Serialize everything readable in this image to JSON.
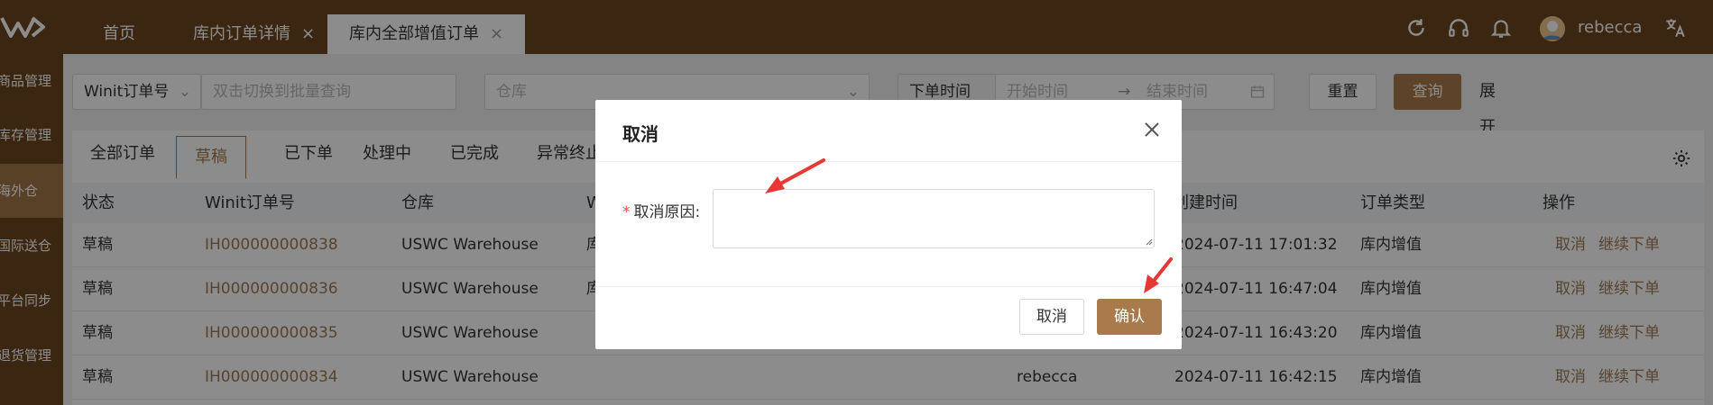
{
  "header": {
    "tabs": [
      {
        "label": "首页"
      },
      {
        "label": "库内订单详情",
        "close": "×"
      },
      {
        "label": "库内全部增值订单",
        "close": "×"
      }
    ],
    "user_name": "rebecca"
  },
  "sidebar": {
    "items": [
      {
        "label": "商品管理"
      },
      {
        "label": "库存管理"
      },
      {
        "label": "海外仓"
      },
      {
        "label": "国际送仓"
      },
      {
        "label": "平台同步"
      },
      {
        "label": "退货管理"
      }
    ]
  },
  "filters": {
    "order_type_select": "Winit订单号",
    "order_search_placeholder": "双击切换到批量查询",
    "warehouse_placeholder": "仓库",
    "time_type_select": "下单时间",
    "start_placeholder": "开始时间",
    "range_arrow": "→",
    "end_placeholder": "结束时间",
    "reset_label": "重置",
    "query_label": "查询",
    "expand_label": "展开"
  },
  "status_tabs": [
    {
      "label": "全部订单"
    },
    {
      "label": "草稿"
    },
    {
      "label": "已下单"
    },
    {
      "label": "处理中"
    },
    {
      "label": "已完成"
    },
    {
      "label": "异常终止"
    }
  ],
  "table": {
    "columns": [
      "状态",
      "Winit订单号",
      "仓库",
      "W",
      "创建时间",
      "订单类型",
      "操作"
    ],
    "rows": [
      {
        "status": "草稿",
        "order": "IH000000000838",
        "warehouse": "USWC Warehouse",
        "w": "库",
        "creator": "",
        "created": "2024-07-11 17:01:32",
        "type": "库内增值",
        "action1": "取消",
        "action2": "继续下单"
      },
      {
        "status": "草稿",
        "order": "IH000000000836",
        "warehouse": "USWC Warehouse",
        "w": "库",
        "creator": "",
        "created": "2024-07-11 16:47:04",
        "type": "库内增值",
        "action1": "取消",
        "action2": "继续下单"
      },
      {
        "status": "草稿",
        "order": "IH000000000835",
        "warehouse": "USWC Warehouse",
        "w": "",
        "creator": "",
        "created": "2024-07-11 16:43:20",
        "type": "库内增值",
        "action1": "取消",
        "action2": "继续下单"
      },
      {
        "status": "草稿",
        "order": "IH000000000834",
        "warehouse": "USWC Warehouse",
        "w": "",
        "creator": "rebecca",
        "created": "2024-07-11 16:42:15",
        "type": "库内增值",
        "action1": "取消",
        "action2": "继续下单"
      }
    ]
  },
  "modal": {
    "title": "取消",
    "field_required_mark": "*",
    "field_label": "取消原因:",
    "reason_value": "",
    "cancel_label": "取消",
    "confirm_label": "确认"
  },
  "colors": {
    "brand_brown": "#6b4520",
    "accent": "#a87a4c",
    "annotation_red": "#e53935"
  }
}
